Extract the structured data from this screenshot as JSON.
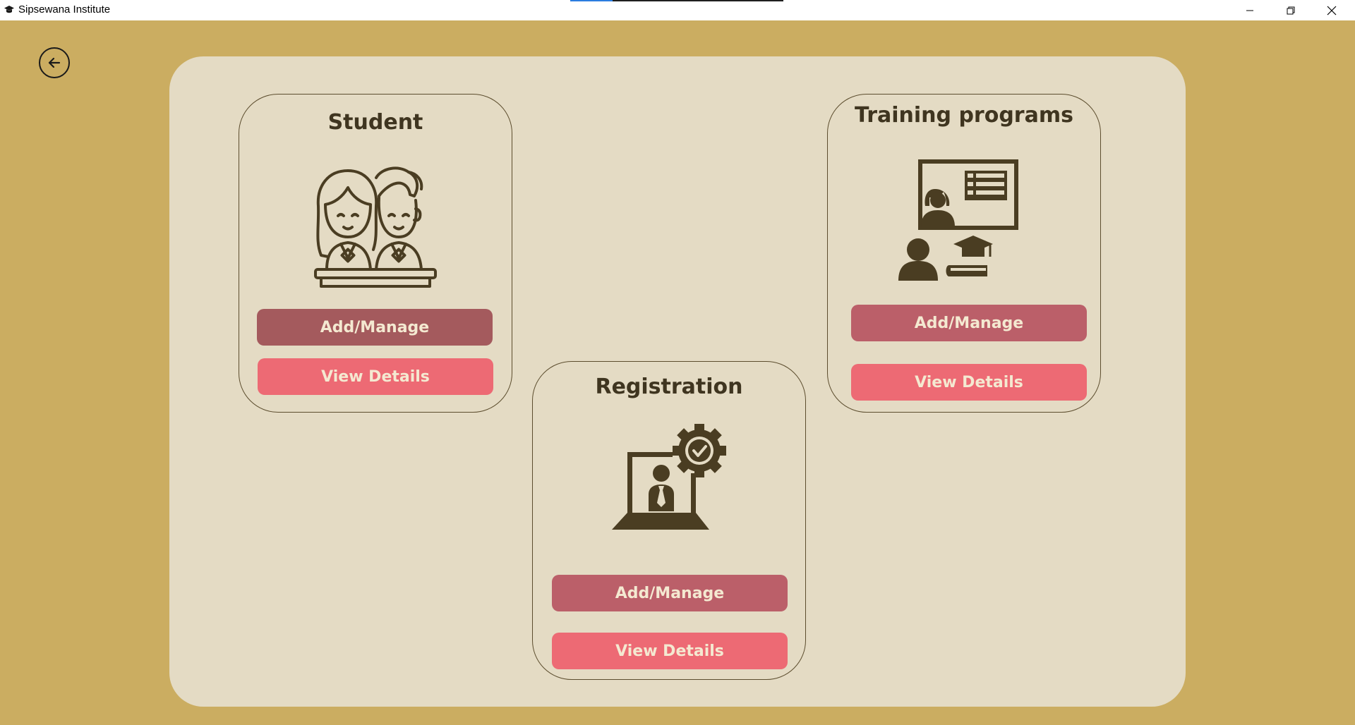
{
  "window": {
    "title": "Sipsewana Institute",
    "loading_progress": 0.2
  },
  "colors": {
    "background": "#cbad61",
    "panel": "#e4dbc4",
    "icon": "#4a3d22",
    "button_manage": "#bb5f69",
    "button_view": "#ed6a74",
    "button_text": "#f4e9d1"
  },
  "back": {
    "icon": "arrow-left-circle"
  },
  "cards": {
    "student": {
      "title": "Student",
      "icon": "students-at-desk-icon",
      "manage_label": "Add/Manage",
      "view_label": "View Details"
    },
    "training": {
      "title": "Training programs",
      "icon": "online-teacher-icon",
      "manage_label": "Add/Manage",
      "view_label": "View Details"
    },
    "registration": {
      "title": "Registration",
      "icon": "laptop-person-gear-check-icon",
      "manage_label": "Add/Manage",
      "view_label": "View Details"
    }
  }
}
